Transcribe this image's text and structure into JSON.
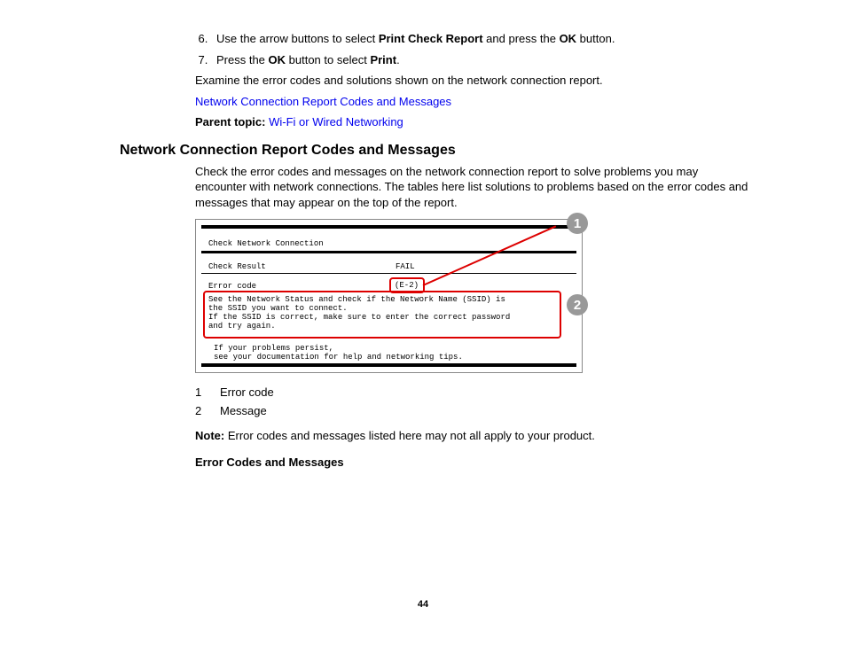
{
  "steps": {
    "6": {
      "pre": "Use the arrow buttons to select ",
      "bold1": "Print Check Report",
      "mid": " and press the ",
      "bold2": "OK",
      "post": " button."
    },
    "7": {
      "pre": "Press the ",
      "bold1": "OK",
      "mid": " button to select ",
      "bold2": "Print",
      "post": "."
    }
  },
  "examine": "Examine the error codes and solutions shown on the network connection report.",
  "link1": "Network Connection Report Codes and Messages",
  "parentTopicLabel": "Parent topic:",
  "parentTopicLink": "Wi-Fi or Wired Networking",
  "heading": "Network Connection Report Codes and Messages",
  "intro": "Check the error codes and messages on the network connection report to solve problems you may encounter with network connections. The tables here list solutions to problems based on the error codes and messages that may appear on the top of the report.",
  "figure": {
    "title": "Check Network Connection",
    "resultLabel": "Check Result",
    "resultValue": "FAIL",
    "errorLabel": "Error code",
    "errorValue": "(E-2)",
    "msg1": "See the Network Status and check if the Network Name (SSID) is",
    "msg2": "the SSID you want to connect.",
    "msg3": "If the SSID is correct, make sure to enter the correct password",
    "msg4": "and try again.",
    "persist1": "If your problems persist,",
    "persist2": "see your documentation for help and networking tips.",
    "callout1": "1",
    "callout2": "2"
  },
  "legend": {
    "n1": "1",
    "t1": "Error code",
    "n2": "2",
    "t2": "Message"
  },
  "noteLabel": "Note:",
  "noteText": " Error codes and messages listed here may not all apply to your product.",
  "subheading": "Error Codes and Messages",
  "pageNumber": "44"
}
